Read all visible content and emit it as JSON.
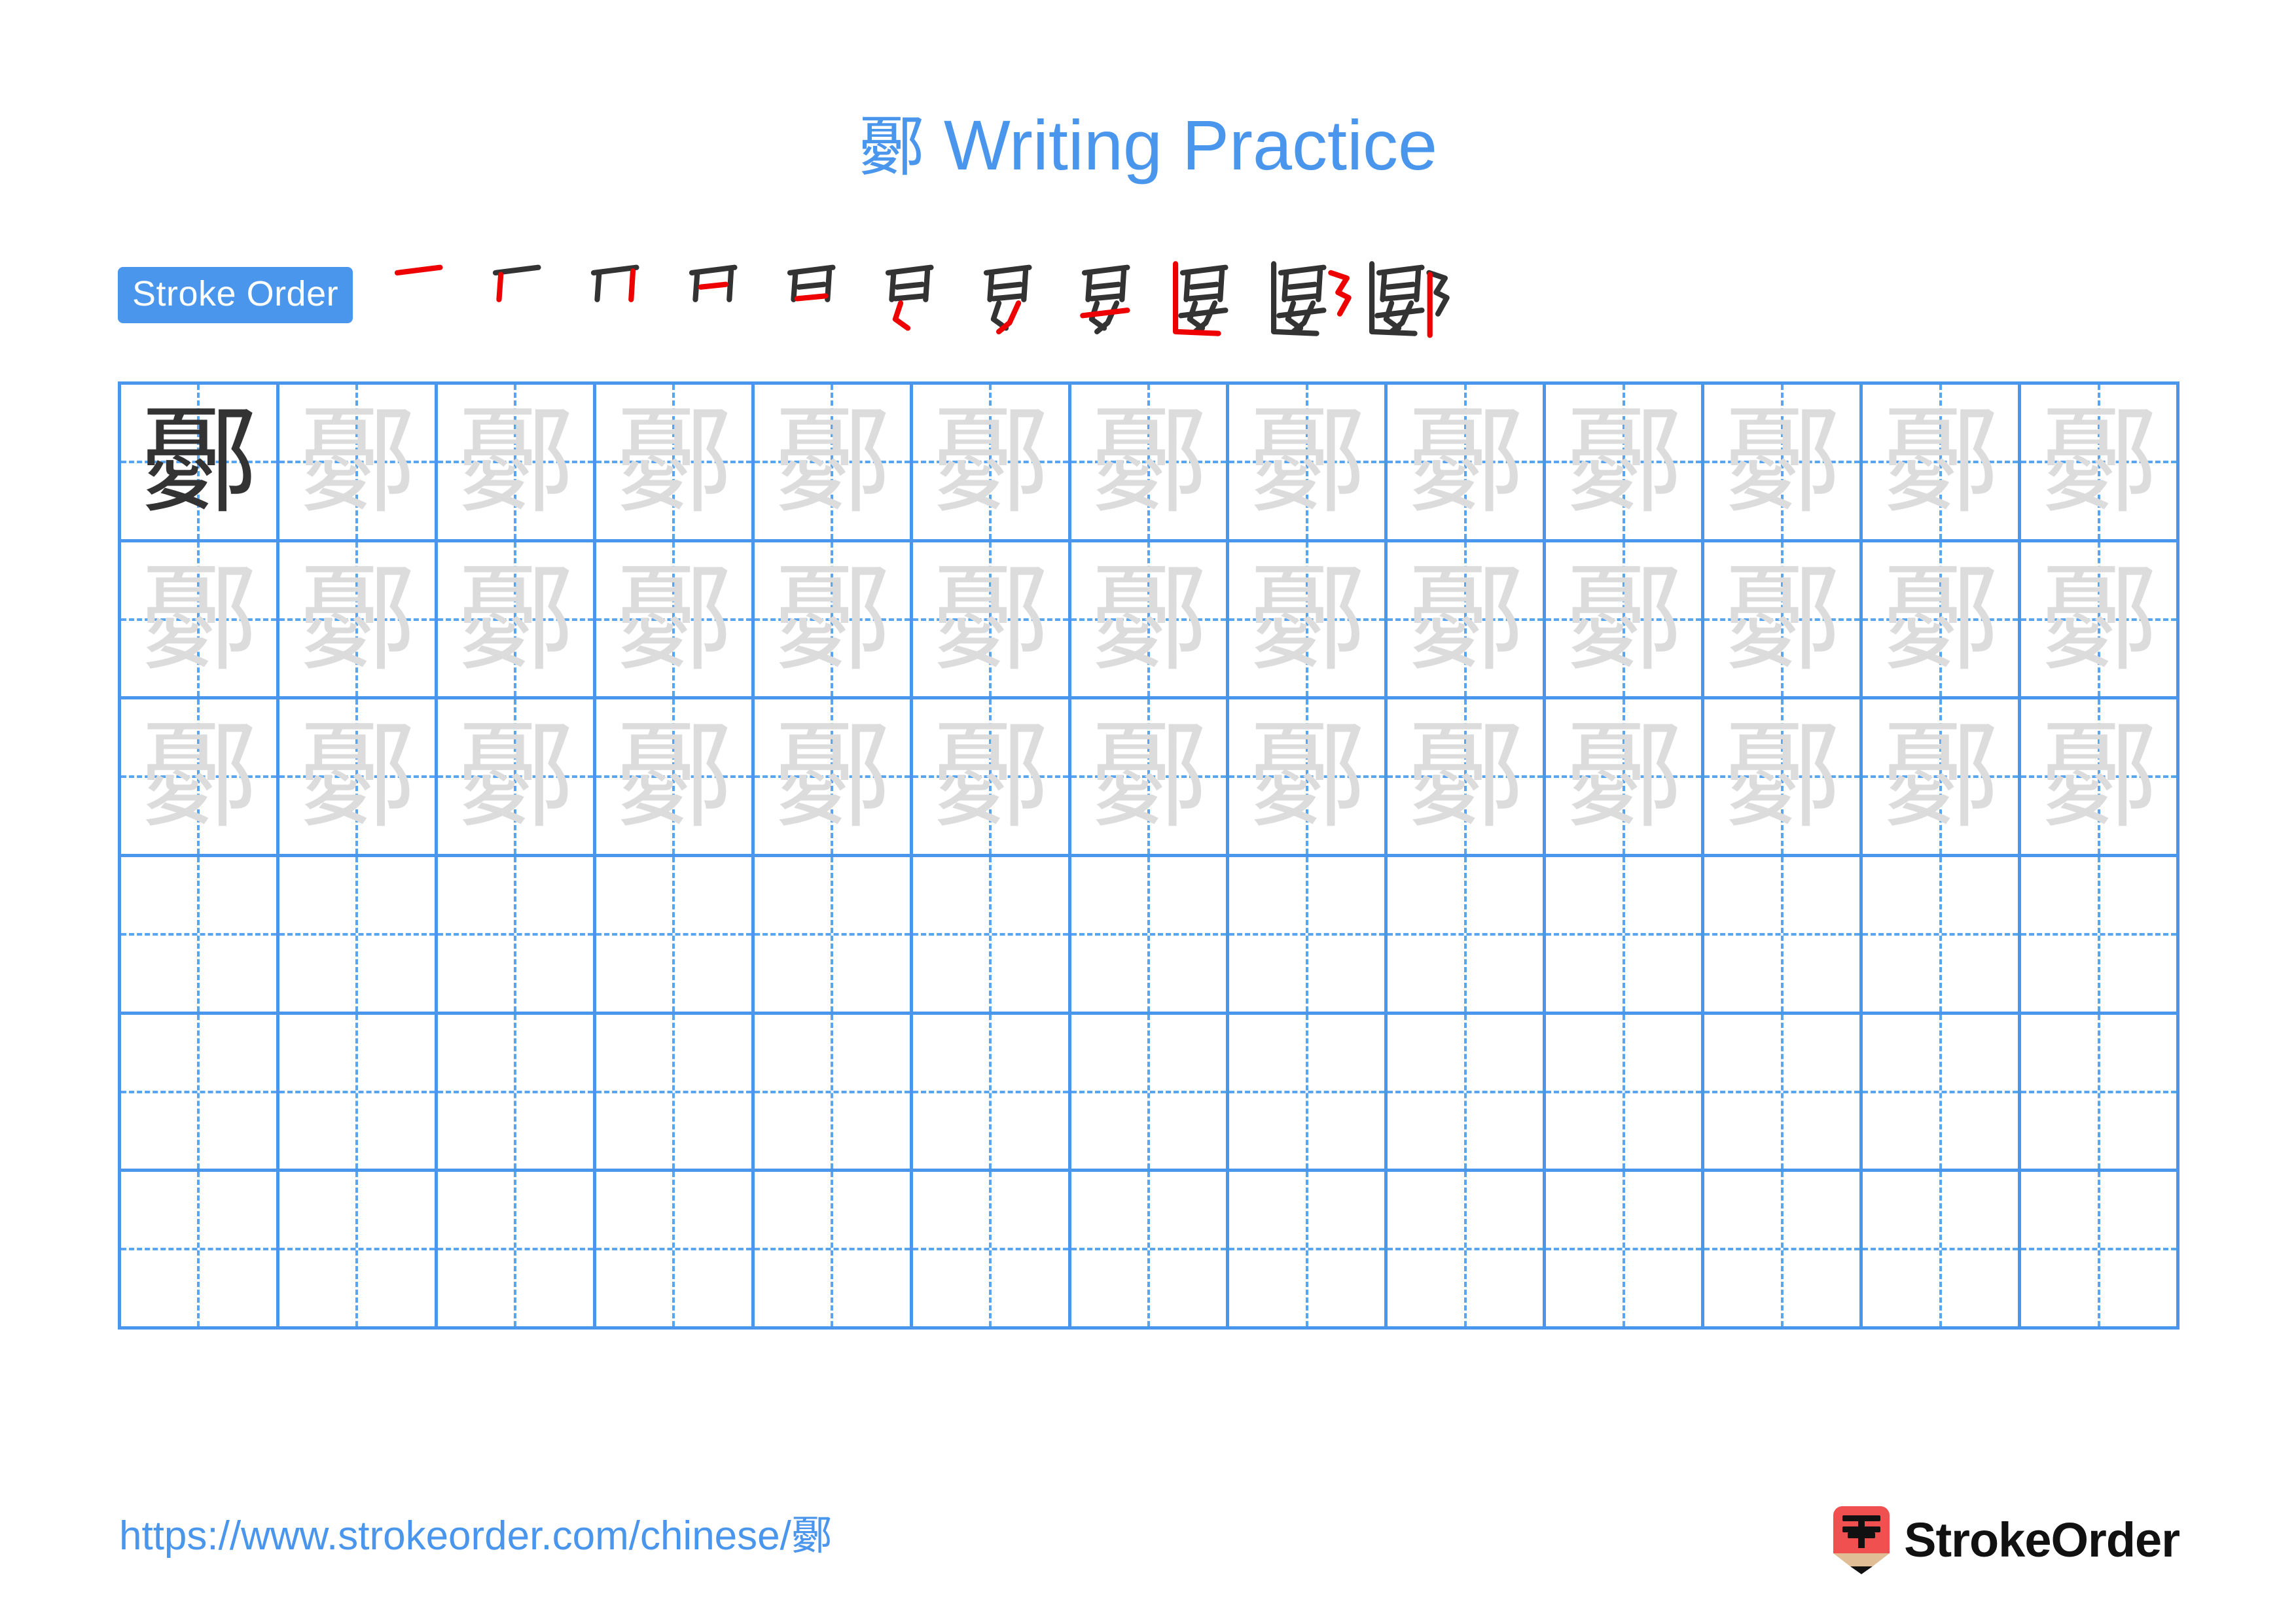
{
  "character": "鄾",
  "header": {
    "title_char": "鄾",
    "title_suffix": " Writing Practice",
    "title_color": "#4a96ec"
  },
  "stroke_order": {
    "badge_label": "Stroke Order",
    "badge_bg": "#4a96ec",
    "badge_text_color": "#ffffff",
    "new_stroke_color": "#ee0000",
    "old_stroke_color": "#333333",
    "total_strokes": 11,
    "steps": [
      {
        "index": 1,
        "stroke_count": 1
      },
      {
        "index": 2,
        "stroke_count": 2
      },
      {
        "index": 3,
        "stroke_count": 3
      },
      {
        "index": 4,
        "stroke_count": 4
      },
      {
        "index": 5,
        "stroke_count": 5
      },
      {
        "index": 6,
        "stroke_count": 6
      },
      {
        "index": 7,
        "stroke_count": 7
      },
      {
        "index": 8,
        "stroke_count": 8
      },
      {
        "index": 9,
        "stroke_count": 9
      },
      {
        "index": 10,
        "stroke_count": 10
      },
      {
        "index": 11,
        "stroke_count": 11
      }
    ]
  },
  "grid": {
    "columns": 13,
    "rows": 6,
    "line_color": "#4a96ec",
    "guide_color": "#5aa5ef",
    "model_char_color": "#333333",
    "trace_char_color": "#dcdcdc",
    "cells": [
      [
        "model",
        "trace",
        "trace",
        "trace",
        "trace",
        "trace",
        "trace",
        "trace",
        "trace",
        "trace",
        "trace",
        "trace",
        "trace"
      ],
      [
        "trace",
        "trace",
        "trace",
        "trace",
        "trace",
        "trace",
        "trace",
        "trace",
        "trace",
        "trace",
        "trace",
        "trace",
        "trace"
      ],
      [
        "trace",
        "trace",
        "trace",
        "trace",
        "trace",
        "trace",
        "trace",
        "trace",
        "trace",
        "trace",
        "trace",
        "trace",
        "trace"
      ],
      [
        "empty",
        "empty",
        "empty",
        "empty",
        "empty",
        "empty",
        "empty",
        "empty",
        "empty",
        "empty",
        "empty",
        "empty",
        "empty"
      ],
      [
        "empty",
        "empty",
        "empty",
        "empty",
        "empty",
        "empty",
        "empty",
        "empty",
        "empty",
        "empty",
        "empty",
        "empty",
        "empty"
      ],
      [
        "empty",
        "empty",
        "empty",
        "empty",
        "empty",
        "empty",
        "empty",
        "empty",
        "empty",
        "empty",
        "empty",
        "empty",
        "empty"
      ]
    ]
  },
  "footer": {
    "url_prefix": "https://www.strokeorder.com/chinese/",
    "url_char": "鄾",
    "url_color": "#4a96ec",
    "brand_name": "StrokeOrder",
    "brand_mark_char": "字",
    "brand_mark_bg": "#f0504f",
    "brand_mark_wood": "#e0bd95"
  }
}
